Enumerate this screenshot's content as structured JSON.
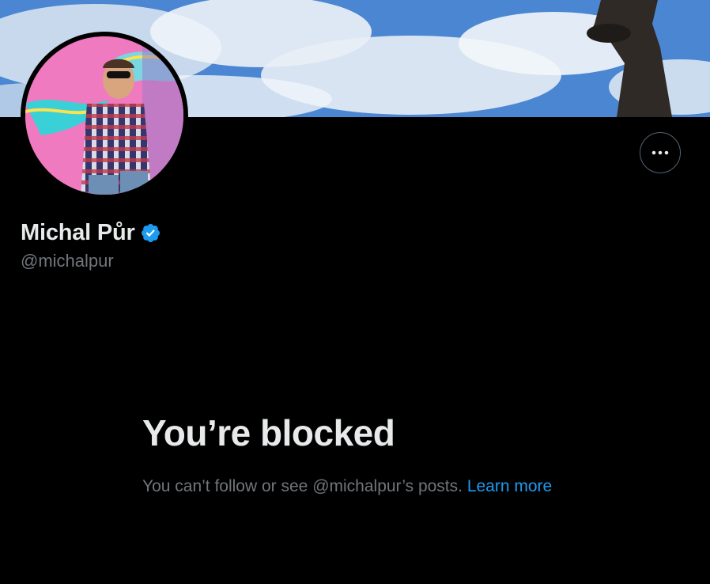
{
  "profile": {
    "display_name": "Michal Půr",
    "handle": "@michalpur",
    "verified": true
  },
  "icons": {
    "more": "more-horizontal-icon",
    "verified": "verified-badge-icon"
  },
  "blocked_notice": {
    "title": "You’re blocked",
    "message": "You can’t follow or see @michalpur’s posts.",
    "learn_more_label": "Learn more"
  },
  "colors": {
    "background": "#000000",
    "primary_text": "#e7e9ea",
    "secondary_text": "#71767b",
    "link": "#1d9bf0",
    "verified_badge": "#1d9bf0",
    "button_border": "#536471"
  }
}
